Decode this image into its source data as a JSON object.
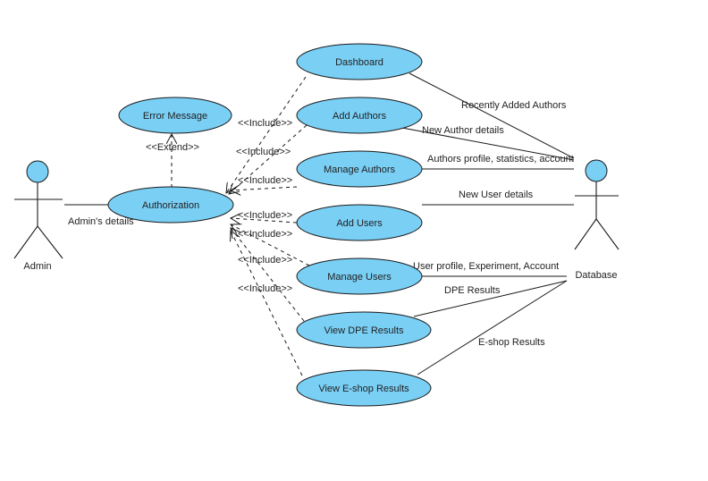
{
  "diagram": {
    "type": "use-case",
    "colors": {
      "use_case_fill": "#7acff5",
      "actor_head_fill": "#7acff5",
      "line": "#1a1a1a"
    },
    "actors": [
      {
        "id": "admin",
        "label": "Admin"
      },
      {
        "id": "database",
        "label": "Database"
      }
    ],
    "use_cases": [
      {
        "id": "error",
        "label": "Error Message"
      },
      {
        "id": "auth",
        "label": "Authorization"
      },
      {
        "id": "dashboard",
        "label": "Dashboard"
      },
      {
        "id": "add_authors",
        "label": "Add Authors"
      },
      {
        "id": "manage_authors",
        "label": "Manage Authors"
      },
      {
        "id": "add_users",
        "label": "Add Users"
      },
      {
        "id": "manage_users",
        "label": "Manage Users"
      },
      {
        "id": "view_dpe",
        "label": "View DPE Results"
      },
      {
        "id": "view_eshop",
        "label": "View E-shop Results"
      }
    ],
    "relations": {
      "admin_auth": "Admin's details",
      "extend": "<<Extend>>",
      "include": "<<Include>>",
      "db_dashboard": "Recently Added Authors",
      "db_add_authors": "New Author details",
      "db_manage_authors": "Authors profile, statistics, account",
      "db_add_users": "New User details",
      "db_manage_users": "User profile, Experiment, Account",
      "db_dpe": "DPE Results",
      "db_eshop": "E-shop Results"
    }
  }
}
